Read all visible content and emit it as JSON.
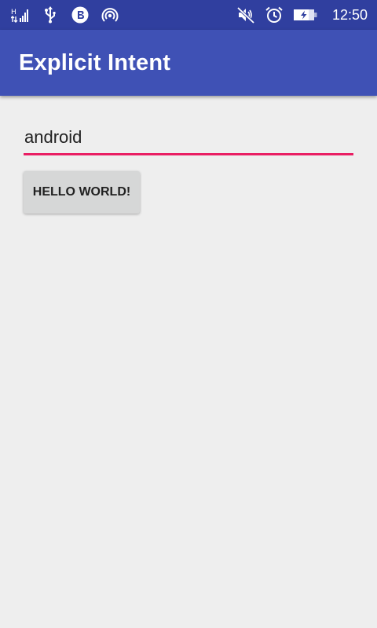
{
  "status_bar": {
    "left_icons": [
      "signal-icon",
      "usb-icon",
      "bluetooth-app-icon",
      "hotspot-icon"
    ],
    "right_icons": [
      "vibrate-mute-icon",
      "alarm-icon",
      "battery-charging-icon"
    ],
    "time": "12:50"
  },
  "app_bar": {
    "title": "Explicit Intent",
    "color": "#3f51b5"
  },
  "form": {
    "input_value": "android",
    "input_underline_color": "#e91e63",
    "button_label": "HELLO WORLD!"
  },
  "colors": {
    "status_bar": "#303f9f",
    "background": "#eeeeee",
    "button": "#d6d7d7"
  }
}
